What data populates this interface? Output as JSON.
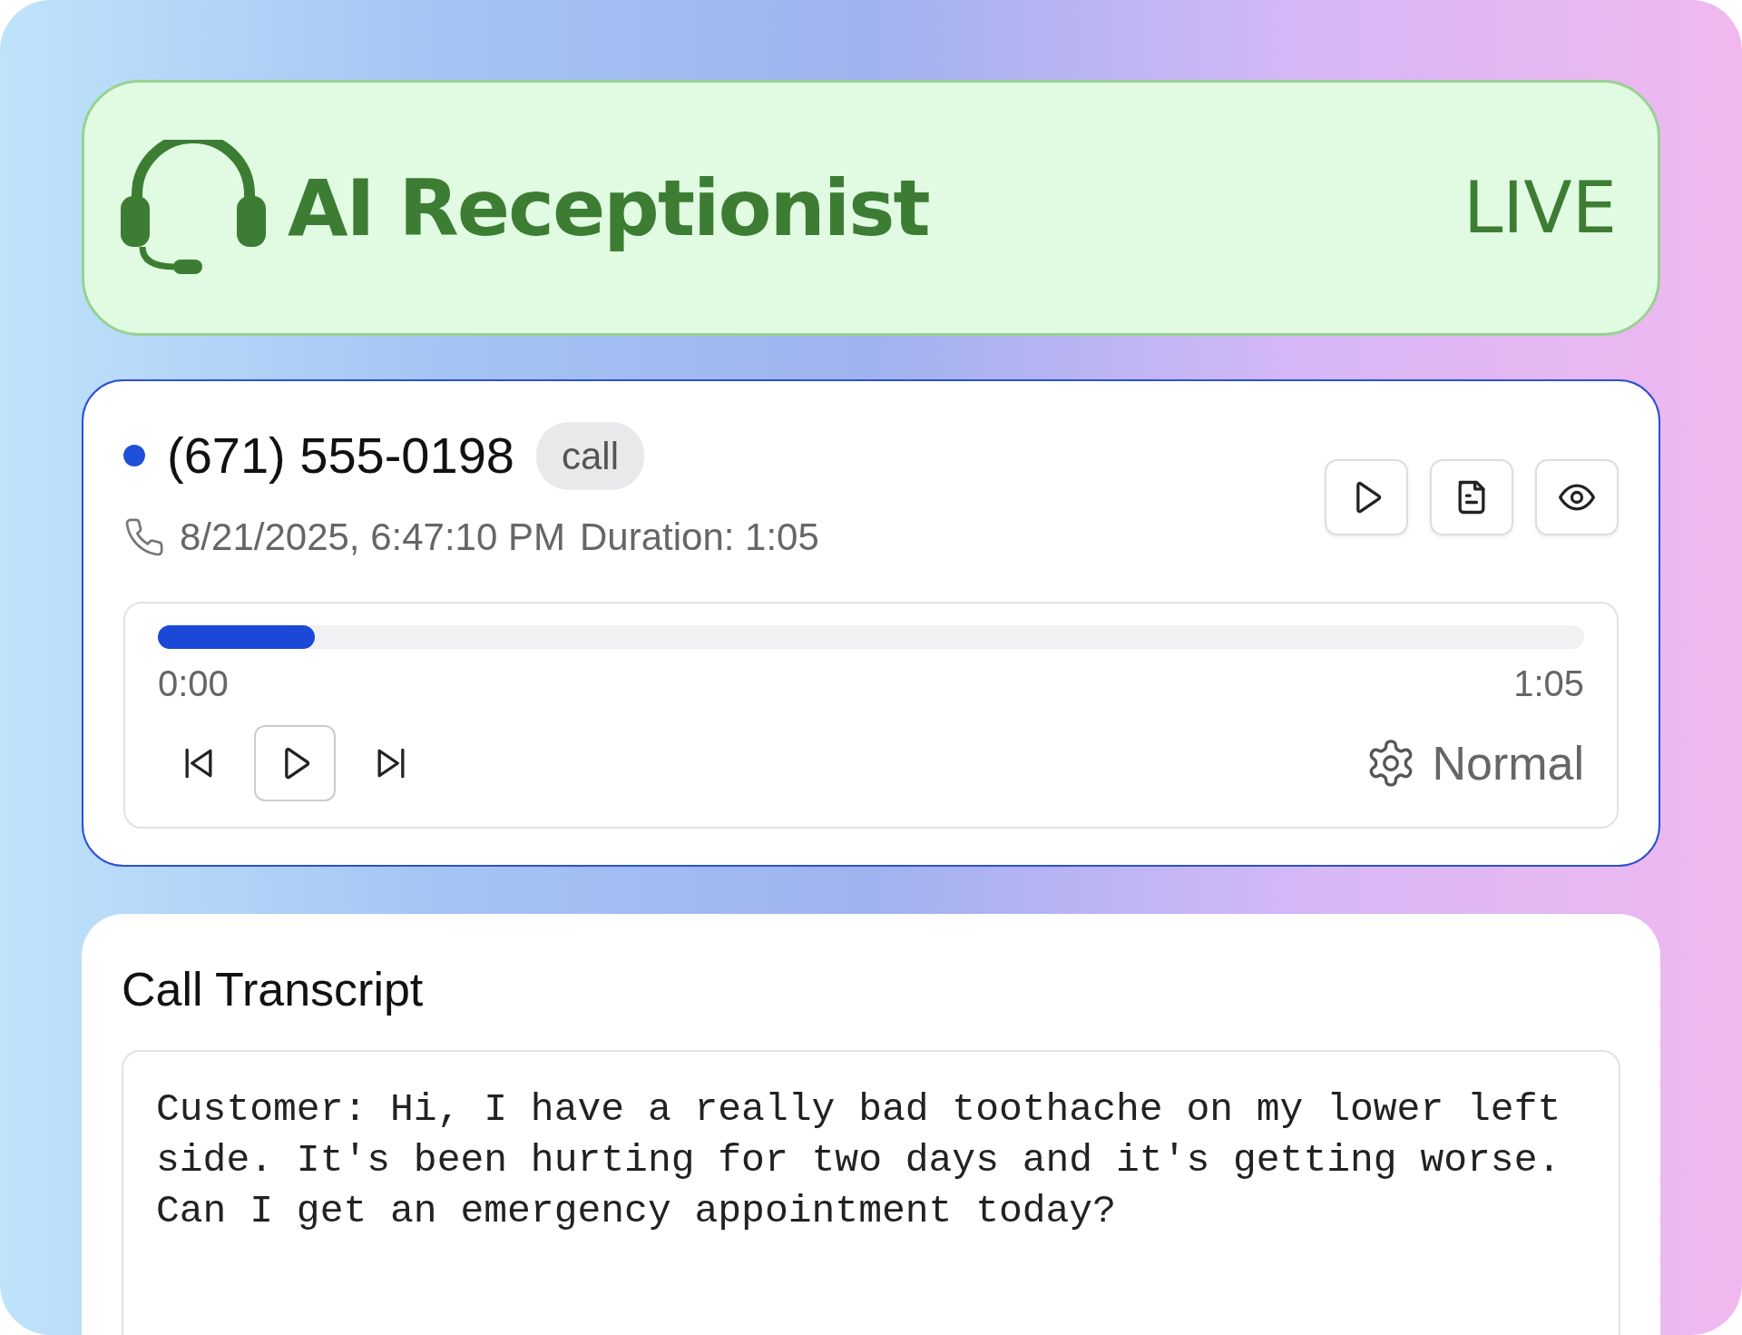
{
  "header": {
    "title": "AI Receptionist",
    "status": "LIVE"
  },
  "call": {
    "phone": "(671) 555-0198",
    "color": "#1f4fd8",
    "tag": "call",
    "datetime": "8/21/2025, 6:47:10 PM",
    "duration": "Duration: 1:05",
    "actions": [
      {
        "kind": "play"
      },
      {
        "kind": "document"
      },
      {
        "kind": "view"
      }
    ]
  },
  "player": {
    "level": 0.11,
    "elapsed": "0:00",
    "total": "1:05",
    "controls": [
      {
        "kind": "previous"
      },
      {
        "kind": "play"
      },
      {
        "kind": "next"
      }
    ],
    "speed": "Normal"
  },
  "transcript": {
    "title": "Call Transcript",
    "text": "Customer: Hi, I have a really bad toothache on my lower left side. It's been hurting for two days and it's getting worse. Can I get an emergency appointment today?"
  }
}
